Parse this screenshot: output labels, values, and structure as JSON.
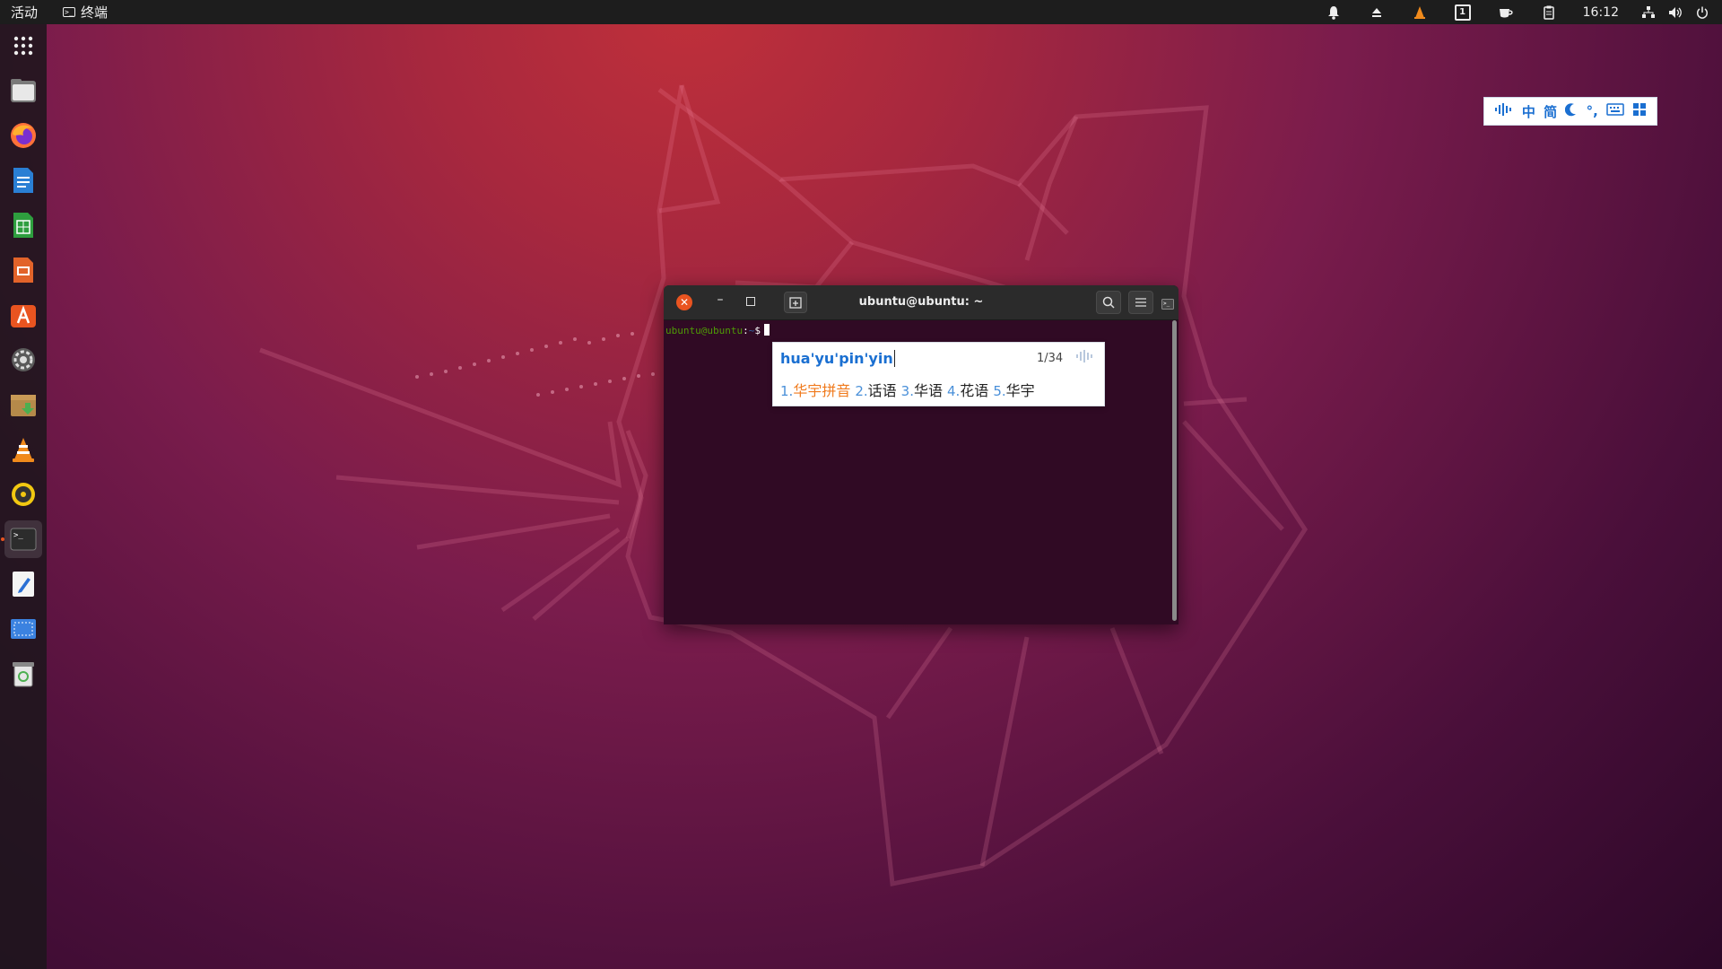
{
  "topbar": {
    "activities": "活动",
    "app_name": "终端",
    "clock": "16:12",
    "tray_workspace": "1",
    "tray_icons": [
      "bell-icon",
      "eject-icon",
      "vlc-tray-icon",
      "workspace-indicator",
      "tea-cup-icon",
      "clipboard-icon",
      "network-icon",
      "volume-icon",
      "power-icon"
    ]
  },
  "dock": {
    "items": [
      {
        "name": "show-apps-icon"
      },
      {
        "name": "files-icon"
      },
      {
        "name": "firefox-icon"
      },
      {
        "name": "writer-icon"
      },
      {
        "name": "calc-icon"
      },
      {
        "name": "impress-icon"
      },
      {
        "name": "software-center-icon"
      },
      {
        "name": "settings-icon"
      },
      {
        "name": "archive-manager-icon"
      },
      {
        "name": "vlc-icon"
      },
      {
        "name": "rhythmbox-icon"
      },
      {
        "name": "terminal-icon"
      },
      {
        "name": "text-editor-icon"
      },
      {
        "name": "screenshot-icon"
      },
      {
        "name": "trash-icon"
      }
    ],
    "active_item": "terminal-icon"
  },
  "ime_panel": {
    "mode": "中",
    "charset": "简",
    "punct": "°,"
  },
  "terminal": {
    "title": "ubuntu@ubuntu: ~",
    "prompt_user": "ubuntu@ubuntu",
    "prompt_colon": ":",
    "prompt_path": "~",
    "prompt_sign": "$"
  },
  "ime_popup": {
    "preedit": "hua'yu'pin'yin",
    "page": "1/34",
    "candidates": [
      {
        "num": "1.",
        "text": "华宇拼音",
        "selected": true
      },
      {
        "num": "2.",
        "text": "话语",
        "selected": false
      },
      {
        "num": "3.",
        "text": "华语",
        "selected": false
      },
      {
        "num": "4.",
        "text": "花语",
        "selected": false
      },
      {
        "num": "5.",
        "text": "华宇",
        "selected": false
      }
    ]
  },
  "colors": {
    "accent": "#e95420",
    "terminal_bg": "#300a24",
    "ime_blue": "#1a6fd1",
    "candidate_selected": "#f07a1c"
  }
}
